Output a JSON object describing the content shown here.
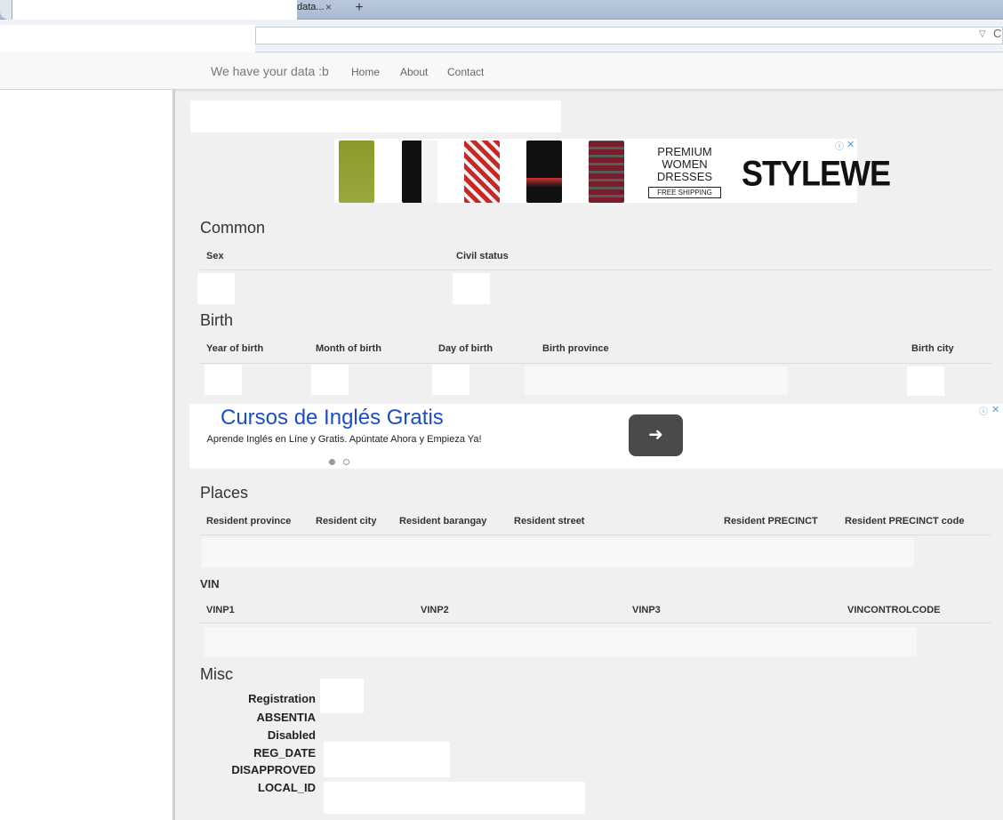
{
  "browser": {
    "tab_title": "data...",
    "tab_close": "×",
    "new_tab": "+",
    "url_dropdown": "▽",
    "reload": "C"
  },
  "nav": {
    "brand": "We have your data :b",
    "links": [
      "Home",
      "About",
      "Contact"
    ]
  },
  "ads": {
    "top": {
      "premium_text": "PREMIUM\nWOMEN\nDRESSES",
      "free_shipping": "FREE SHIPPING",
      "brand": "STYLEWE",
      "adchoice": "ⓘ",
      "close": "✕"
    },
    "mid": {
      "headline": "Cursos de Inglés Gratis",
      "description": "Aprende Inglés en Línе y Gratis. Apúntate Ahora y Empieza Ya!",
      "arrow": "➜",
      "adchoice": "ⓘ",
      "close": "✕"
    }
  },
  "sections": {
    "common": {
      "title": "Common",
      "columns": [
        "Sex",
        "Civil status"
      ]
    },
    "birth": {
      "title": "Birth",
      "columns": [
        "Year of birth",
        "Month of birth",
        "Day of birth",
        "Birth province",
        "Birth city"
      ]
    },
    "places": {
      "title": "Places",
      "columns": [
        "Resident province",
        "Resident city",
        "Resident barangay",
        "Resident street",
        "Resident PRECINCT",
        "Resident PRECINCT code"
      ]
    },
    "vin": {
      "title": "VIN",
      "columns": [
        "VINP1",
        "VINP2",
        "VINP3",
        "VINCONTROLCODE"
      ]
    },
    "misc": {
      "title": "Misc",
      "labels": [
        "Registration",
        "ABSENTIA",
        "Disabled",
        "REG_DATE",
        "DISAPPROVED",
        "LOCAL_ID"
      ]
    }
  },
  "colors": {
    "ad_headline": "#1a4ec9",
    "brand_text": "#777777",
    "page_bg": "#f0f0f0"
  }
}
